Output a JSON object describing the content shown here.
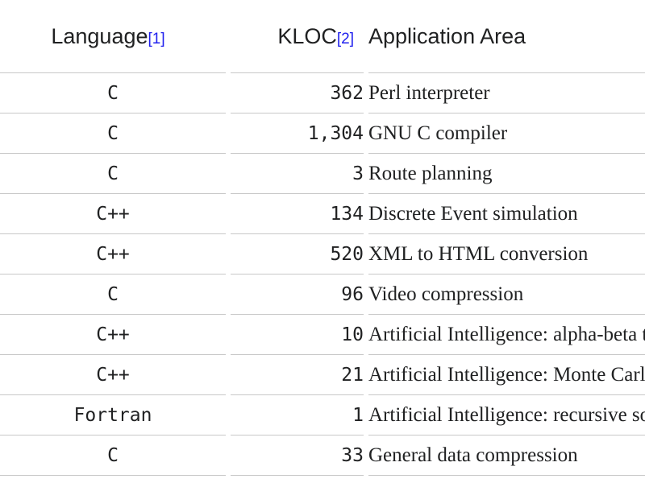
{
  "table": {
    "columns": [
      {
        "key": "language",
        "label": "Language",
        "ref": "[1]",
        "align": "center"
      },
      {
        "key": "kloc",
        "label": "KLOC",
        "ref": "[2]",
        "align": "right"
      },
      {
        "key": "area",
        "label": "Application Area",
        "ref": "",
        "align": "left"
      }
    ],
    "rows": [
      {
        "language": "C",
        "kloc": "362",
        "area": "Perl interpreter"
      },
      {
        "language": "C",
        "kloc": "1,304",
        "area": "GNU C compiler"
      },
      {
        "language": "C",
        "kloc": "3",
        "area": "Route planning"
      },
      {
        "language": "C++",
        "kloc": "134",
        "area": "Discrete Event simulation"
      },
      {
        "language": "C++",
        "kloc": "520",
        "area": "XML to HTML conversion"
      },
      {
        "language": "C",
        "kloc": "96",
        "area": "Video compression"
      },
      {
        "language": "C++",
        "kloc": "10",
        "area": "Artificial Intelligence: alpha-beta tree search"
      },
      {
        "language": "C++",
        "kloc": "21",
        "area": "Artificial Intelligence: Monte Carlo tree search"
      },
      {
        "language": "Fortran",
        "kloc": "1",
        "area": "Artificial Intelligence: recursive solution generator"
      },
      {
        "language": "C",
        "kloc": "33",
        "area": "General data compression"
      }
    ]
  },
  "colors": {
    "text": "#202122",
    "reference_link": "#2020ee",
    "border": "#c8c8c8",
    "background": "#ffffff"
  }
}
